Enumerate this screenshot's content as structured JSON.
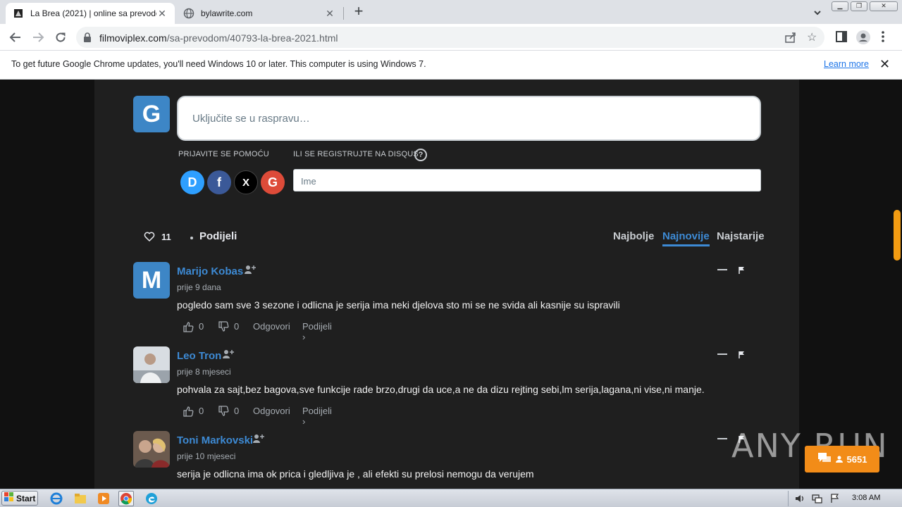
{
  "browser": {
    "tabs": [
      {
        "title": "La Brea (2021) | online sa prevodom",
        "active": true
      },
      {
        "title": "bylawrite.com",
        "active": false
      }
    ],
    "url_host": "filmoviplex.com",
    "url_path": "/sa-prevodom/40793-la-brea-2021.html",
    "infobar_message": "To get future Google Chrome updates, you'll need Windows 10 or later. This computer is using Windows 7.",
    "infobar_link": "Learn more"
  },
  "disqus": {
    "avatar_letter": "G",
    "compose_placeholder": "Uključite se u raspravu…",
    "login_label": "PRIJAVITE SE POMOĆU",
    "register_label": "ILI SE REGISTRUJTE NA DISQUS",
    "help_mark": "?",
    "name_placeholder": "Ime",
    "social": [
      "D",
      "f",
      "X",
      "G"
    ],
    "likes": "11",
    "share": "Podijeli",
    "sort": [
      "Najbolje",
      "Najnovije",
      "Najstarije"
    ],
    "active_sort": "Najnovije"
  },
  "comments": [
    {
      "author": "Marijo Kobas",
      "avatar_letter": "M",
      "time": "prije 9 dana",
      "text": "pogledo sam sve 3 sezone i odlicna je serija ima neki djelova sto mi se ne svida ali kasnije su ispravili",
      "upvotes": "0",
      "downvotes": "0",
      "reply": "Odgovori",
      "share": "Podijeli ›"
    },
    {
      "author": "Leo Tron",
      "avatar_letter": "",
      "time": "prije 8 mjeseci",
      "text": "pohvala za sajt,bez bagova,sve funkcije rade brzo,drugi da uce,a ne da dizu rejting sebi,lm serija,lagana,ni vise,ni manje.",
      "upvotes": "0",
      "downvotes": "0",
      "reply": "Odgovori",
      "share": "Podijeli ›"
    },
    {
      "author": "Toni Markovski",
      "avatar_letter": "",
      "time": "prije 10 mjeseci",
      "text": "serija je odlicna ima ok prica i gledljiva je , ali efekti su prelosi nemogu da verujem",
      "upvotes": "",
      "downvotes": "",
      "reply": "",
      "share": ""
    }
  ],
  "overlay": {
    "watermark": "ANY RUN",
    "badge_count": "5651"
  },
  "taskbar": {
    "start": "Start",
    "clock": "3:08 AM"
  },
  "colors": {
    "accent": "#3d8ad4",
    "badge": "#f28c18",
    "page_bg": "#1f1f1f"
  }
}
